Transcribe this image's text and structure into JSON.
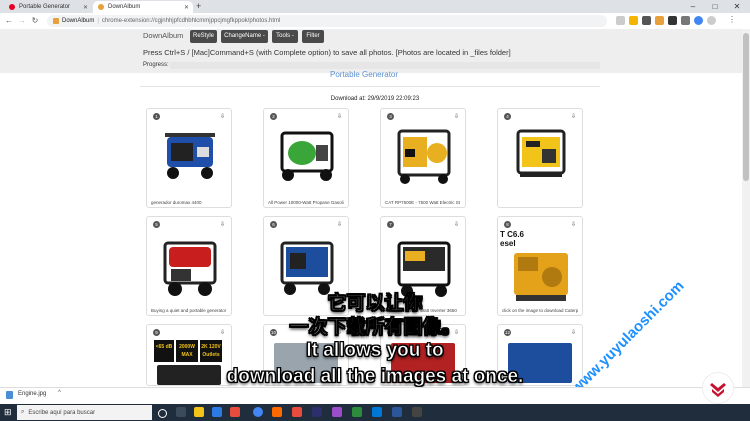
{
  "browser": {
    "tabs": [
      {
        "label": "Portable Generator",
        "favicon_color": "#e60023",
        "active": false
      },
      {
        "label": "DownAlbum",
        "favicon_color": "#e8a13a",
        "active": true
      }
    ],
    "new_tab": "+",
    "window_controls": [
      "–",
      "□",
      "✕"
    ],
    "address": {
      "site_label": "DownAlbum",
      "url": "chrome-extension://cgjnhhjpfcdhbhlcmmjppcjmgfkppok/photos.html"
    }
  },
  "header": {
    "brand": "DownAlbum",
    "buttons": [
      "ReStyle",
      "ChangeName -",
      "Tools -",
      "Filter"
    ],
    "instruction": "Press Ctrl+S / [Mac]Command+S (with Complete option) to save all photos. [Photos are located in _files folder]",
    "progress_label": "Progress:",
    "progress_value": 0
  },
  "page": {
    "ghost_title": "Portable Generator",
    "download_at": "Download at: 29/9/2019 22:09:23"
  },
  "cards": [
    {
      "num": "1",
      "caption": "generador duromax 4400",
      "image": "blue-generator"
    },
    {
      "num": "2",
      "caption": "All Power 10000-Watt Propane Gasoli",
      "image": "green-generator"
    },
    {
      "num": "3",
      "caption": "CAT RP7500E - 7500 Watt Electric St",
      "image": "yellow-generator"
    },
    {
      "num": "4",
      "caption": "",
      "image": "wen-generator"
    },
    {
      "num": "5",
      "caption": "Buying a quiet and portable generator",
      "image": "red-generator"
    },
    {
      "num": "6",
      "caption": "",
      "image": "westinghouse-generator"
    },
    {
      "num": "7",
      "caption": "PowerPRO 3650 Watt Inverter 3650",
      "image": "black-yellow-generator"
    },
    {
      "num": "8",
      "caption": "click on the image to download Caterp",
      "image": "cat-engine"
    },
    {
      "num": "9",
      "caption": "",
      "image": "inverter-generator"
    },
    {
      "num": "10",
      "caption": "",
      "image": "silver-generator"
    },
    {
      "num": "11",
      "caption": "",
      "image": "red-generator-2"
    },
    {
      "num": "12",
      "caption": "",
      "image": "blue-generator-2"
    }
  ],
  "card_overlay_text": "T C6.6\nesel",
  "inverter_badges": [
    "<65 dB",
    "2000W MAX",
    "2K 120V Outlets"
  ],
  "subtitles": {
    "zh_line1": "它可以让你",
    "zh_line2": "一次下载所有图像。",
    "en_line1": "It allows you to",
    "en_line2": "download all the images at once."
  },
  "watermark": "www.yuyulaoshi.com",
  "download_shelf": {
    "file": "Engine.jpg"
  },
  "taskbar": {
    "search_placeholder": "Escribe aquí para buscar"
  },
  "colors": {
    "header_button": "#4a4a4a",
    "header_bg": "#eeeeee",
    "taskbar": "#1f2d3d",
    "logo_red": "#c8102e"
  }
}
